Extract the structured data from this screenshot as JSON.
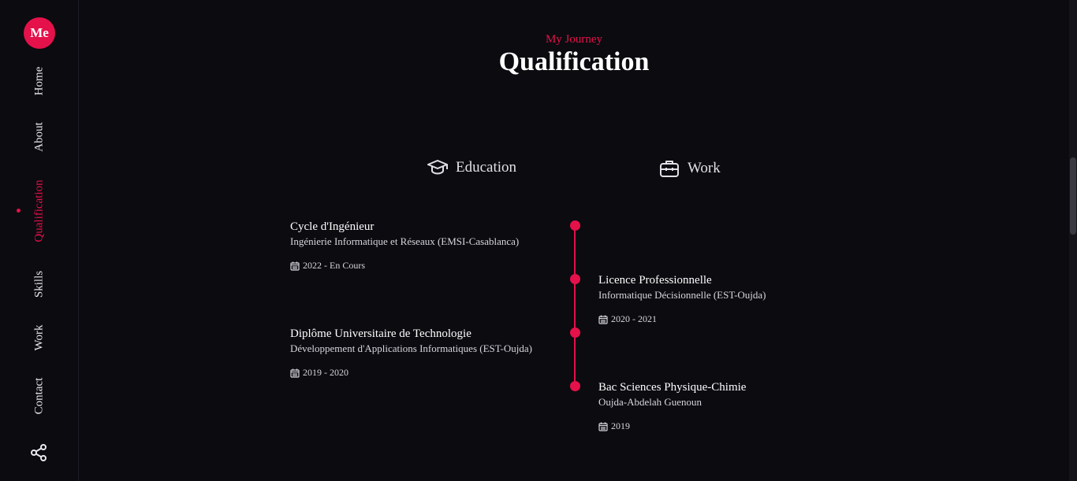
{
  "sidebar": {
    "logo": "Me",
    "nav": [
      {
        "label": "Home"
      },
      {
        "label": "About"
      },
      {
        "label": "Qualification",
        "active": true
      },
      {
        "label": "Skills"
      },
      {
        "label": "Work"
      },
      {
        "label": "Contact"
      }
    ],
    "share_icon": "share-icon"
  },
  "header": {
    "subtitle": "My Journey",
    "title": "Qualification"
  },
  "tabs": [
    {
      "label": "Education",
      "icon": "graduation-cap-icon"
    },
    {
      "label": "Work",
      "icon": "briefcase-icon"
    }
  ],
  "timeline": [
    {
      "title": "Cycle d'Ingénieur",
      "subtitle": "Ingénierie Informatique et Réseaux (EMSI-Casablanca)",
      "date": "2022 - En Cours",
      "side": "left"
    },
    {
      "title": "Licence Professionnelle",
      "subtitle": "Informatique Décisionnelle (EST-Oujda)",
      "date": "2020 - 2021",
      "side": "right"
    },
    {
      "title": "Diplôme Universitaire de Technologie",
      "subtitle": "Développement d'Applications Informatiques (EST-Oujda)",
      "date": "2019 - 2020",
      "side": "left"
    },
    {
      "title": "Bac Sciences Physique-Chimie",
      "subtitle": "Oujda-Abdelah Guenoun",
      "date": "2019",
      "side": "right"
    }
  ],
  "colors": {
    "accent": "#e5114a",
    "background": "#0b0b10",
    "text": "#e8e8ee"
  }
}
